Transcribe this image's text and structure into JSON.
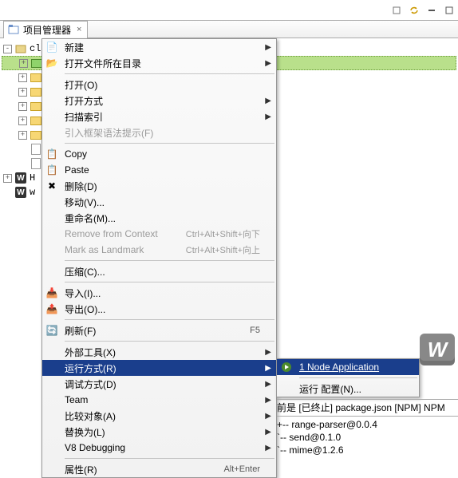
{
  "pane": {
    "title": "项目管理器",
    "close": "×"
  },
  "tree": {
    "root": "client",
    "children": [
      "",
      "",
      "",
      "",
      "",
      "",
      "",
      ""
    ],
    "webstorm_h": "H",
    "webstorm_w": "w"
  },
  "context_menu": {
    "new": "新建",
    "open_in_folder": "打开文件所在目录",
    "open": "打开(O)",
    "open_with": "打开方式",
    "scan_index": "扫描索引",
    "import_syntax_hint": "引入框架语法提示(F)",
    "copy": "Copy",
    "paste": "Paste",
    "delete": "删除(D)",
    "move": "移动(V)...",
    "rename": "重命名(M)...",
    "remove_context": "Remove from Context",
    "remove_context_sc": "Ctrl+Alt+Shift+向下",
    "mark_landmark": "Mark as Landmark",
    "mark_landmark_sc": "Ctrl+Alt+Shift+向上",
    "compress": "压缩(C)...",
    "import": "导入(I)...",
    "export": "导出(O)...",
    "refresh": "刷新(F)",
    "refresh_sc": "F5",
    "external_tools": "外部工具(X)",
    "run_as": "运行方式(R)",
    "debug_as": "调试方式(D)",
    "team": "Team",
    "compare_with": "比较对象(A)",
    "replace_with": "替换为(L)",
    "v8_debugging": "V8 Debugging",
    "properties": "属性(R)",
    "properties_sc": "Alt+Enter"
  },
  "submenu": {
    "node_app": "1 Node Application",
    "node_app_underline": "1",
    "run_config": "运行 配置(N)..."
  },
  "console": {
    "header": "前是 [已终止] package.json [NPM] NPM",
    "line1": "+-- range-parser@0.0.4",
    "line2": "`-- send@0.1.0",
    "line3": "  `-- mime@1.2.6"
  },
  "big_w": "W"
}
